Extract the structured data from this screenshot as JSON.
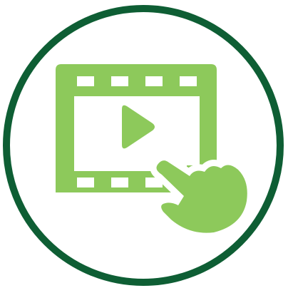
{
  "icon": {
    "name": "video-touch-icon",
    "ring_color": "#0E5E34",
    "symbol_color": "#8DC95B",
    "background_color": "#FFFFFF",
    "film_perforations_per_row": 4,
    "film_perforation_rows": 2,
    "elements": [
      "circle-ring-icon",
      "film-strip-icon",
      "play-icon",
      "pointing-hand-icon"
    ]
  }
}
